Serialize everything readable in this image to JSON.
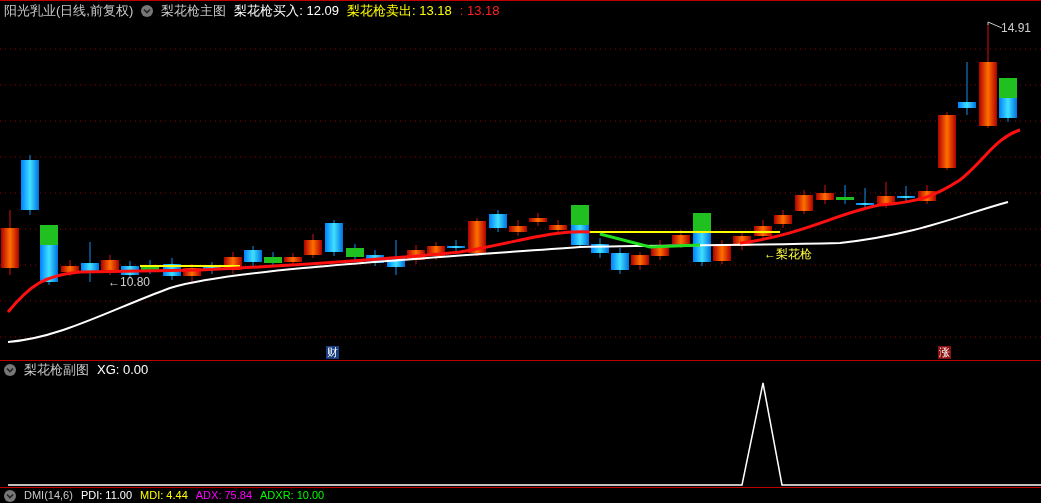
{
  "header": {
    "symbol": "阳光乳业(日线,前复权)",
    "indicator": "梨花枪主图",
    "readouts": [
      {
        "text": "梨花枪买入: 12.09",
        "color": "#ffffff"
      },
      {
        "text": "梨花枪卖出: 13.18",
        "color": "#ffff00"
      },
      {
        "text": ": 13.18",
        "color": "#ff2020"
      }
    ]
  },
  "main_chart": {
    "price_labels": [
      {
        "text": "14.91"
      },
      {
        "text": "←10.80"
      }
    ],
    "signal_label": "←梨花枪",
    "markers": [
      {
        "text": "财",
        "kind": "finance"
      },
      {
        "text": "涨",
        "kind": "limit_up"
      }
    ]
  },
  "sub_chart": {
    "title": "梨花枪副图",
    "readouts": [
      {
        "text": "XG: 0.00",
        "color": "#ffffff"
      }
    ]
  },
  "bottom_indicator": {
    "title": "DMI(14,6)",
    "readouts": [
      {
        "text": "PDI: 11.00",
        "color": "#ffffff"
      },
      {
        "text": "MDI: 4.44",
        "color": "#ffff00"
      },
      {
        "text": "ADX: 75.84",
        "color": "#ff00ff"
      },
      {
        "text": "ADXR: 10.00",
        "color": "#00ff00"
      }
    ]
  }
}
